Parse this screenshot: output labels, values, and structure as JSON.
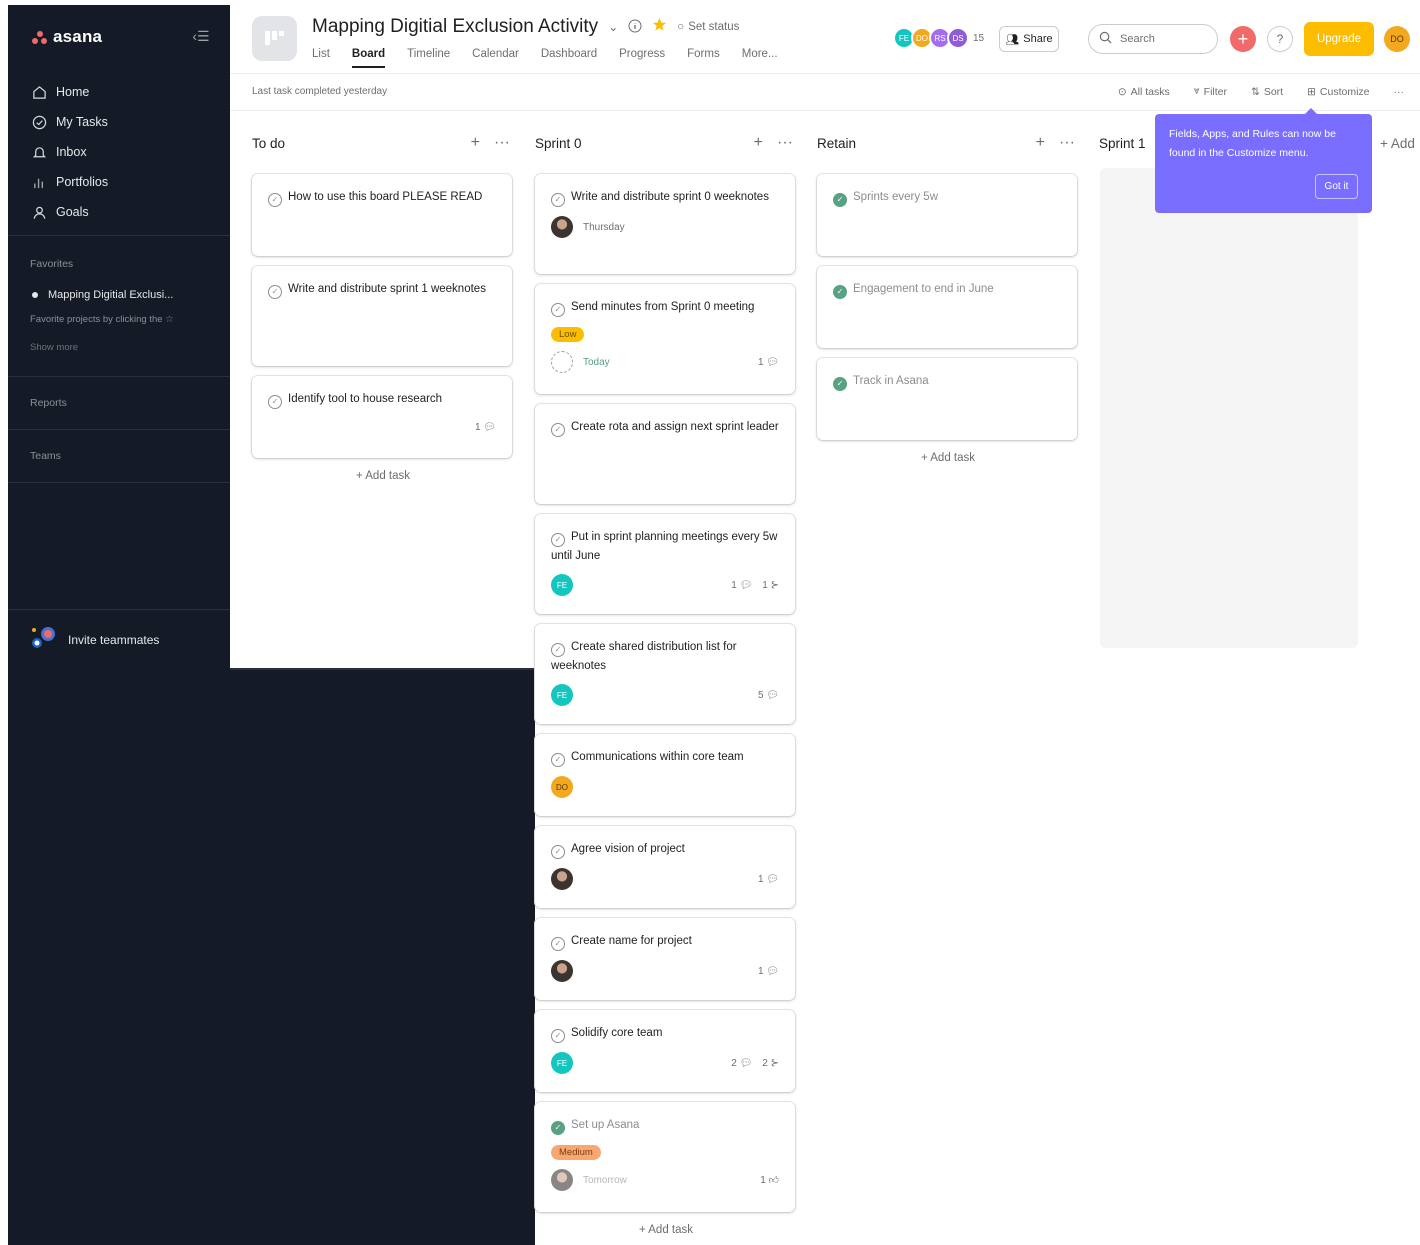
{
  "sidebar": {
    "brand": "asana",
    "nav": [
      {
        "label": "Home",
        "icon": "home-icon"
      },
      {
        "label": "My Tasks",
        "icon": "check-circle-icon"
      },
      {
        "label": "Inbox",
        "icon": "bell-icon"
      },
      {
        "label": "Portfolios",
        "icon": "bar-chart-icon"
      },
      {
        "label": "Goals",
        "icon": "person-icon"
      }
    ],
    "favorites_label": "Favorites",
    "favorite_project": "Mapping Digitial Exclusi...",
    "favorites_hint": "Favorite projects by clicking the ☆",
    "show_more": "Show more",
    "reports_label": "Reports",
    "teams_label": "Teams",
    "invite_label": "Invite teammates"
  },
  "header": {
    "project_title": "Mapping Digitial Exclusion Activity",
    "set_status": "Set status",
    "tabs": [
      "List",
      "Board",
      "Timeline",
      "Calendar",
      "Dashboard",
      "Progress",
      "Forms",
      "More..."
    ],
    "active_tab": "Board",
    "members": [
      {
        "initials": "FE",
        "color": "#13c7c0"
      },
      {
        "initials": "DO",
        "color": "#f2a91f"
      },
      {
        "initials": "RS",
        "color": "#a46cf0"
      },
      {
        "initials": "DS",
        "color": "#8e5cd9"
      }
    ],
    "member_count": "15",
    "share_label": "Share",
    "search_placeholder": "Search",
    "upgrade_label": "Upgrade",
    "user_initials": "DO"
  },
  "subbar": {
    "last_task": "Last task completed yesterday",
    "all_tasks": "All tasks",
    "filter": "Filter",
    "sort": "Sort",
    "customize": "Customize"
  },
  "columns": {
    "todo": {
      "title": "To do",
      "cards": [
        {
          "title": "How to use this board PLEASE READ"
        },
        {
          "title": "Write and distribute sprint 1 weeknotes"
        },
        {
          "title": "Identify tool to house research",
          "comments": "1"
        }
      ]
    },
    "sprint0": {
      "title": "Sprint 0",
      "cards": [
        {
          "title": "Write and distribute sprint 0 weeknotes",
          "due": "Thursday"
        },
        {
          "title": "Send minutes from Sprint 0 meeting",
          "tag": "Low",
          "due": "Today",
          "comments": "1"
        },
        {
          "title": "Create rota and assign next sprint leader"
        },
        {
          "title": "Put in sprint planning meetings every 5w until June",
          "assignee": "FE",
          "comments": "1",
          "subtasks": "1"
        },
        {
          "title": "Create shared distribution list for weeknotes",
          "assignee": "FE",
          "comments": "5"
        },
        {
          "title": "Communications within core team",
          "assignee": "DO"
        },
        {
          "title": "Agree vision of project",
          "comments": "1"
        },
        {
          "title": "Create name for project",
          "comments": "1"
        },
        {
          "title": "Solidify core team",
          "assignee": "FE",
          "comments": "2",
          "subtasks": "2"
        },
        {
          "title": "Set up Asana",
          "tag": "Medium",
          "due": "Tomorrow",
          "likes": "1"
        }
      ]
    },
    "retain": {
      "title": "Retain",
      "cards": [
        {
          "title": "Sprints every 5w"
        },
        {
          "title": "Engagement to end in June"
        },
        {
          "title": "Track in Asana"
        }
      ]
    },
    "sprint1": {
      "title": "Sprint 1"
    },
    "add_task": "+ Add task",
    "add_section": "+ Add"
  },
  "tooltip": {
    "text": "Fields, Apps, and Rules can now be found in the Customize menu.",
    "button": "Got it"
  }
}
